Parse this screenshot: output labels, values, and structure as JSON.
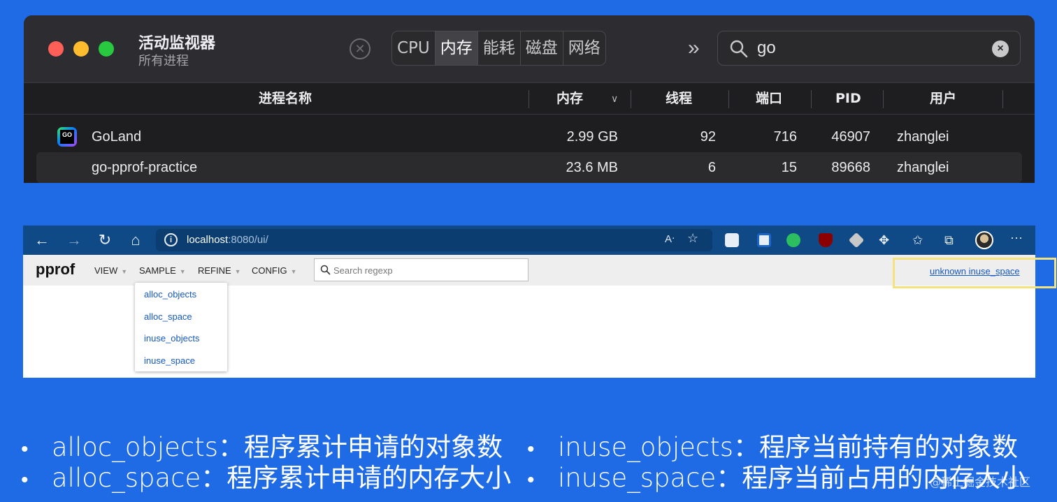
{
  "activity_monitor": {
    "title": "活动监视器",
    "subtitle": "所有进程",
    "tabs": [
      "CPU",
      "内存",
      "能耗",
      "磁盘",
      "网络"
    ],
    "active_tab": "内存",
    "search_value": "go",
    "columns": {
      "name": "进程名称",
      "memory": "内存",
      "threads": "线程",
      "ports": "端口",
      "pid": "PID",
      "user": "用户"
    },
    "rows": [
      {
        "name": "GoLand",
        "memory": "2.99 GB",
        "threads": "92",
        "ports": "716",
        "pid": "46907",
        "user": "zhanglei"
      },
      {
        "name": "go-pprof-practice",
        "memory": "23.6 MB",
        "threads": "6",
        "ports": "15",
        "pid": "89668",
        "user": "zhanglei"
      }
    ]
  },
  "browser": {
    "url_host": "localhost",
    "url_rest": ":8080/ui/",
    "pprof": {
      "logo": "pprof",
      "menus": [
        "VIEW",
        "SAMPLE",
        "REFINE",
        "CONFIG"
      ],
      "search_placeholder": "Search regexp",
      "legend": "unknown inuse_space",
      "sample_options": [
        "alloc_objects",
        "alloc_space",
        "inuse_objects",
        "inuse_space"
      ]
    },
    "accent": "#0f4a86"
  },
  "bullets": [
    {
      "term": "alloc_objects",
      "desc": "：程序累计申请的对象数"
    },
    {
      "term": "alloc_space",
      "desc": "：程序累计申请的内存大小"
    },
    {
      "term": "inuse_objects",
      "desc": "：程序当前持有的对象数"
    },
    {
      "term": "inuse_space",
      "desc": "：程序当前占用的内存大小"
    }
  ],
  "watermark": "@稀土掘金技术社区"
}
